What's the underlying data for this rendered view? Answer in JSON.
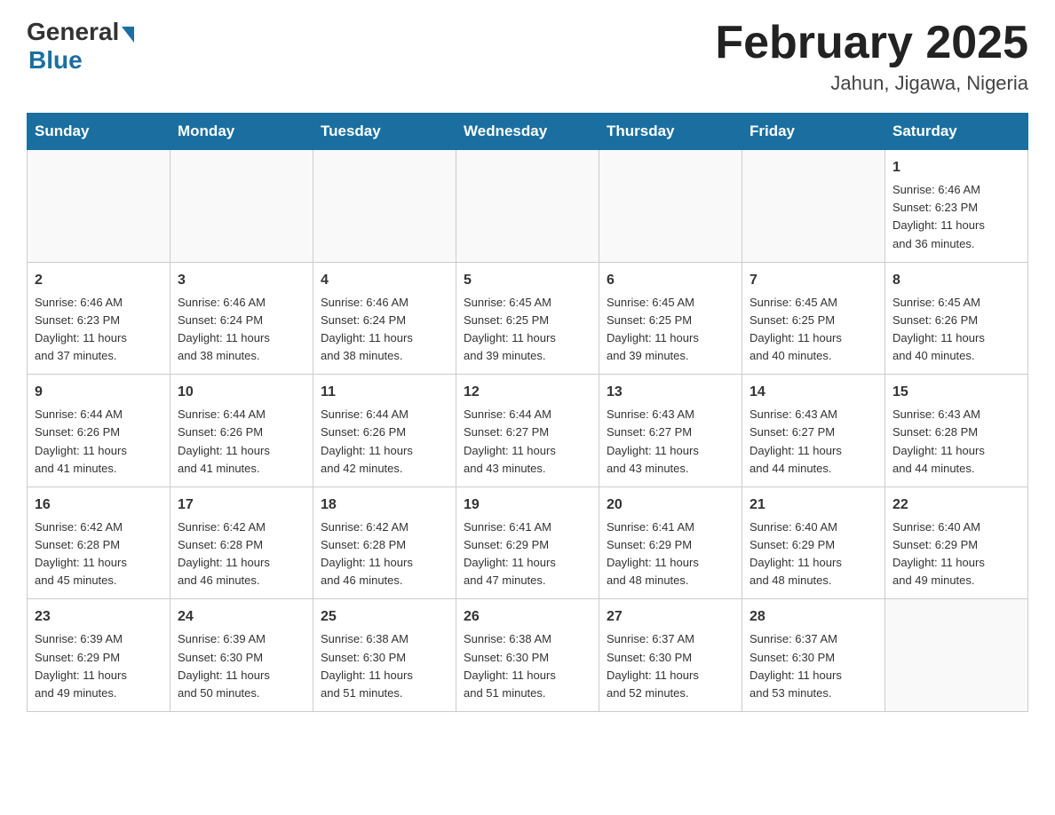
{
  "header": {
    "logo_general": "General",
    "logo_blue": "Blue",
    "month_title": "February 2025",
    "location": "Jahun, Jigawa, Nigeria"
  },
  "days_of_week": [
    "Sunday",
    "Monday",
    "Tuesday",
    "Wednesday",
    "Thursday",
    "Friday",
    "Saturday"
  ],
  "weeks": [
    [
      {
        "day": "",
        "info": ""
      },
      {
        "day": "",
        "info": ""
      },
      {
        "day": "",
        "info": ""
      },
      {
        "day": "",
        "info": ""
      },
      {
        "day": "",
        "info": ""
      },
      {
        "day": "",
        "info": ""
      },
      {
        "day": "1",
        "info": "Sunrise: 6:46 AM\nSunset: 6:23 PM\nDaylight: 11 hours\nand 36 minutes."
      }
    ],
    [
      {
        "day": "2",
        "info": "Sunrise: 6:46 AM\nSunset: 6:23 PM\nDaylight: 11 hours\nand 37 minutes."
      },
      {
        "day": "3",
        "info": "Sunrise: 6:46 AM\nSunset: 6:24 PM\nDaylight: 11 hours\nand 38 minutes."
      },
      {
        "day": "4",
        "info": "Sunrise: 6:46 AM\nSunset: 6:24 PM\nDaylight: 11 hours\nand 38 minutes."
      },
      {
        "day": "5",
        "info": "Sunrise: 6:45 AM\nSunset: 6:25 PM\nDaylight: 11 hours\nand 39 minutes."
      },
      {
        "day": "6",
        "info": "Sunrise: 6:45 AM\nSunset: 6:25 PM\nDaylight: 11 hours\nand 39 minutes."
      },
      {
        "day": "7",
        "info": "Sunrise: 6:45 AM\nSunset: 6:25 PM\nDaylight: 11 hours\nand 40 minutes."
      },
      {
        "day": "8",
        "info": "Sunrise: 6:45 AM\nSunset: 6:26 PM\nDaylight: 11 hours\nand 40 minutes."
      }
    ],
    [
      {
        "day": "9",
        "info": "Sunrise: 6:44 AM\nSunset: 6:26 PM\nDaylight: 11 hours\nand 41 minutes."
      },
      {
        "day": "10",
        "info": "Sunrise: 6:44 AM\nSunset: 6:26 PM\nDaylight: 11 hours\nand 41 minutes."
      },
      {
        "day": "11",
        "info": "Sunrise: 6:44 AM\nSunset: 6:26 PM\nDaylight: 11 hours\nand 42 minutes."
      },
      {
        "day": "12",
        "info": "Sunrise: 6:44 AM\nSunset: 6:27 PM\nDaylight: 11 hours\nand 43 minutes."
      },
      {
        "day": "13",
        "info": "Sunrise: 6:43 AM\nSunset: 6:27 PM\nDaylight: 11 hours\nand 43 minutes."
      },
      {
        "day": "14",
        "info": "Sunrise: 6:43 AM\nSunset: 6:27 PM\nDaylight: 11 hours\nand 44 minutes."
      },
      {
        "day": "15",
        "info": "Sunrise: 6:43 AM\nSunset: 6:28 PM\nDaylight: 11 hours\nand 44 minutes."
      }
    ],
    [
      {
        "day": "16",
        "info": "Sunrise: 6:42 AM\nSunset: 6:28 PM\nDaylight: 11 hours\nand 45 minutes."
      },
      {
        "day": "17",
        "info": "Sunrise: 6:42 AM\nSunset: 6:28 PM\nDaylight: 11 hours\nand 46 minutes."
      },
      {
        "day": "18",
        "info": "Sunrise: 6:42 AM\nSunset: 6:28 PM\nDaylight: 11 hours\nand 46 minutes."
      },
      {
        "day": "19",
        "info": "Sunrise: 6:41 AM\nSunset: 6:29 PM\nDaylight: 11 hours\nand 47 minutes."
      },
      {
        "day": "20",
        "info": "Sunrise: 6:41 AM\nSunset: 6:29 PM\nDaylight: 11 hours\nand 48 minutes."
      },
      {
        "day": "21",
        "info": "Sunrise: 6:40 AM\nSunset: 6:29 PM\nDaylight: 11 hours\nand 48 minutes."
      },
      {
        "day": "22",
        "info": "Sunrise: 6:40 AM\nSunset: 6:29 PM\nDaylight: 11 hours\nand 49 minutes."
      }
    ],
    [
      {
        "day": "23",
        "info": "Sunrise: 6:39 AM\nSunset: 6:29 PM\nDaylight: 11 hours\nand 49 minutes."
      },
      {
        "day": "24",
        "info": "Sunrise: 6:39 AM\nSunset: 6:30 PM\nDaylight: 11 hours\nand 50 minutes."
      },
      {
        "day": "25",
        "info": "Sunrise: 6:38 AM\nSunset: 6:30 PM\nDaylight: 11 hours\nand 51 minutes."
      },
      {
        "day": "26",
        "info": "Sunrise: 6:38 AM\nSunset: 6:30 PM\nDaylight: 11 hours\nand 51 minutes."
      },
      {
        "day": "27",
        "info": "Sunrise: 6:37 AM\nSunset: 6:30 PM\nDaylight: 11 hours\nand 52 minutes."
      },
      {
        "day": "28",
        "info": "Sunrise: 6:37 AM\nSunset: 6:30 PM\nDaylight: 11 hours\nand 53 minutes."
      },
      {
        "day": "",
        "info": ""
      }
    ]
  ]
}
